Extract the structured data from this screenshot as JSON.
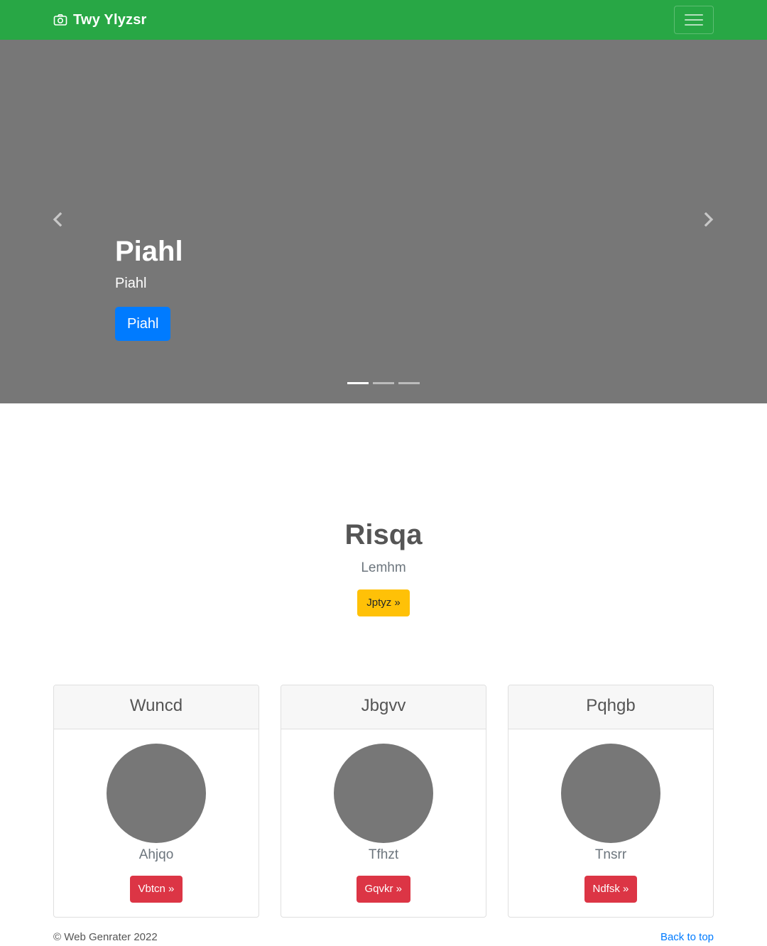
{
  "colors": {
    "navbar": "#28a745",
    "carousel_bg": "#777777",
    "primary_button": "#007bff",
    "warning_button": "#ffc107",
    "danger_button": "#dc3545",
    "link": "#007bff"
  },
  "navbar": {
    "brand_icon": "camera-icon",
    "brand": "Twy Ylyzsr",
    "toggler_icon": "hamburger-icon"
  },
  "carousel": {
    "prev_icon": "chevron-left-icon",
    "next_icon": "chevron-right-icon",
    "caption_title": "Piahl",
    "caption_text": "Piahl",
    "caption_button": "Piahl",
    "indicators": [
      {
        "active": true
      },
      {
        "active": false
      },
      {
        "active": false
      }
    ]
  },
  "jumbotron": {
    "title": "Risqa",
    "lead": "Lemhm",
    "button": "Jptyz »"
  },
  "cards": [
    {
      "header": "Wuncd",
      "text": "Ahjqo",
      "button": "Vbtcn »"
    },
    {
      "header": "Jbgvv",
      "text": "Tfhzt",
      "button": "Gqvkr »"
    },
    {
      "header": "Pqhgb",
      "text": "Tnsrr",
      "button": "Ndfsk »"
    }
  ],
  "footer": {
    "copyright": "© Web Genrater 2022",
    "back_to_top": "Back to top"
  }
}
